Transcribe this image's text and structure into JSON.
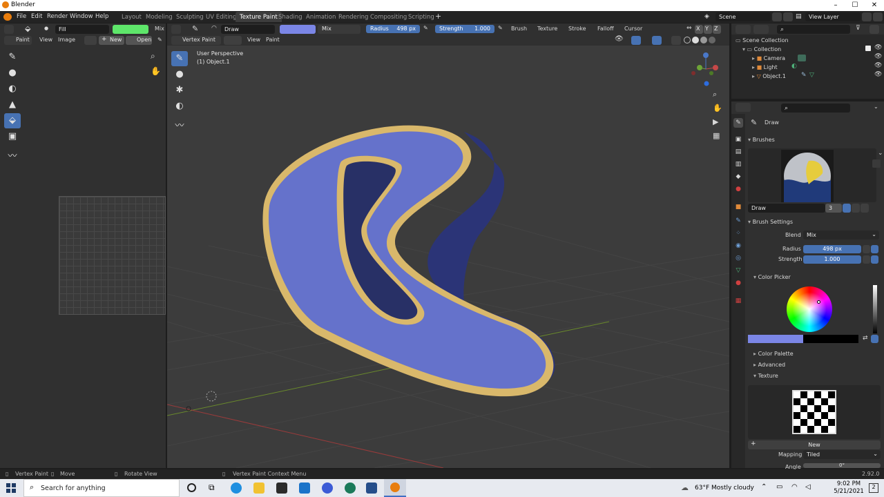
{
  "window": {
    "title": "Blender"
  },
  "menubar": {
    "menus": [
      "File",
      "Edit",
      "Render",
      "Window",
      "Help"
    ],
    "workspaces": [
      "Layout",
      "Modeling",
      "Sculpting",
      "UV Editing",
      "Texture Paint",
      "Shading",
      "Animation",
      "Rendering",
      "Compositing",
      "Scripting"
    ],
    "active_workspace": "Texture Paint",
    "scene": "Scene",
    "view_layer": "View Layer"
  },
  "left_header": {
    "tool": "Fill",
    "blend": "Mix",
    "color": "#5ee66a"
  },
  "left_sub_header": {
    "mode": "Paint",
    "view": "View",
    "image": "Image",
    "new": "New",
    "open": "Open"
  },
  "viewport_header": {
    "tool": "Draw",
    "color": "#7b86e6",
    "blend": "Mix",
    "radius_label": "Radius",
    "radius_value": "498 px",
    "strength_label": "Strength",
    "strength_value": "1.000",
    "menus": [
      "Brush",
      "Texture",
      "Stroke",
      "Falloff",
      "Cursor"
    ],
    "axes": [
      "X",
      "Y",
      "Z"
    ]
  },
  "viewport_sub_header": {
    "mode": "Vertex Paint",
    "view": "View",
    "paint": "Paint"
  },
  "viewport": {
    "perspective": "User Perspective",
    "object": "(1) Object.1"
  },
  "outliner": {
    "root": "Scene Collection",
    "collection": "Collection",
    "items": [
      "Camera",
      "Light",
      "Object.1"
    ]
  },
  "properties": {
    "tool_name": "Draw",
    "brushes_label": "Brushes",
    "brush_name": "Draw",
    "brush_users": "3",
    "brush_settings": "Brush Settings",
    "blend_label": "Blend",
    "blend_value": "Mix",
    "radius_label": "Radius",
    "radius_value": "498 px",
    "strength_label": "Strength",
    "strength_value": "1.000",
    "color_picker": "Color Picker",
    "color_palette": "Color Palette",
    "advanced": "Advanced",
    "texture": "Texture",
    "new_button": "New",
    "mapping_label": "Mapping",
    "mapping_value": "Tiled",
    "angle_label": "Angle",
    "angle_value": "0°"
  },
  "statusbar": {
    "items": [
      "Vertex Paint",
      "Move",
      "Rotate View",
      "Vertex Paint Context Menu"
    ],
    "version": "2.92.0"
  },
  "taskbar": {
    "search_placeholder": "Search for anything",
    "weather": "63°F  Mostly cloudy",
    "time": "9:02 PM",
    "date": "5/21/2021",
    "notifications": "2"
  }
}
